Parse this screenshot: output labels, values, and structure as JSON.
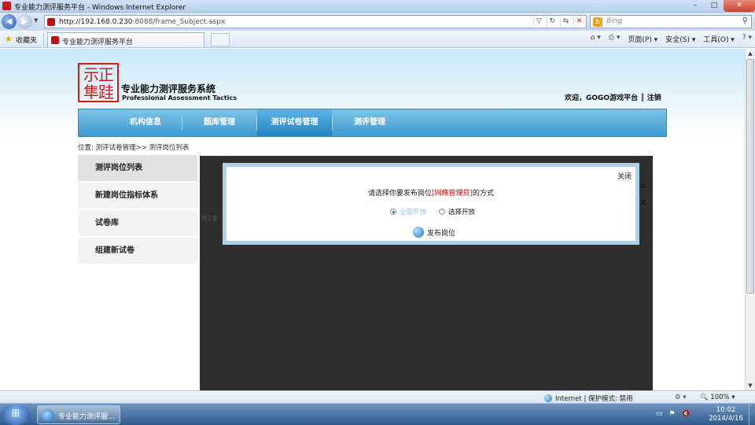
{
  "window": {
    "title": "专业能力测评服务平台 - Windows Internet Explorer",
    "controls": [
      "–",
      "□",
      "✕"
    ]
  },
  "address_bar": {
    "url_host": "http://192.168.0.230",
    "url_rest": ":8088/frame_Subject.aspx",
    "search_placeholder": "Bing"
  },
  "favorites_bar": {
    "favorites_label": "收藏夹",
    "tab_title": "专业能力测评服务平台",
    "commands": [
      "页面(P) ▾",
      "安全(S) ▾",
      "工具(O) ▾"
    ]
  },
  "site": {
    "logo_glyphs": "示正\n隼跬",
    "name": "专业能力测评服务系统",
    "name_en": "Professional Assessment Tactics",
    "welcome": "欢迎，GOGO游戏平台 ║ 注销"
  },
  "nav": {
    "items": [
      "机构信息",
      "题库管理",
      "测评试卷管理",
      "测评管理"
    ],
    "active_index": 2
  },
  "breadcrumb": "位置: 测评试卷管理>> 测评岗位列表",
  "sidebar": {
    "items": [
      "测评岗位列表",
      "新建岗位指标体系",
      "试卷库",
      "组建新试卷"
    ],
    "active_index": 0
  },
  "content": {
    "total_hint": "共2条"
  },
  "modal": {
    "close": "关闭",
    "msg_before": "请选择你要发布岗位",
    "msg_highlight": "[网络管理员]",
    "msg_after": "的方式",
    "options": [
      "全部开放",
      "选择开放"
    ],
    "selected_option": 0,
    "publish_label": "发布岗位"
  },
  "status_bar": {
    "zone": "Internet | 保护模式: 禁用",
    "zoom": "100%"
  },
  "taskbar": {
    "item_label": "专业能力测评服...",
    "time": "10:02",
    "date": "2014/4/16"
  }
}
